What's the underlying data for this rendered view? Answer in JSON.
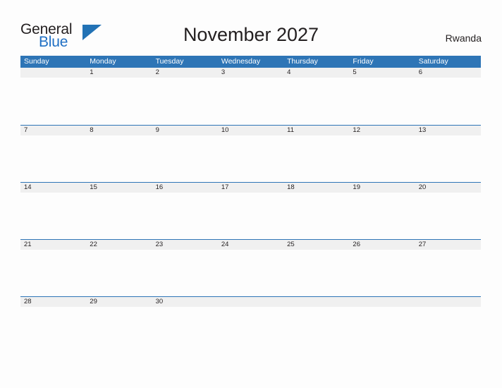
{
  "brand": {
    "word_one": "General",
    "word_two": "Blue",
    "triangle_icon": "triangle-icon",
    "accent_color": "#2272b5",
    "blue_text_color": "#1f6fc4"
  },
  "header": {
    "title": "November 2027",
    "country": "Rwanda"
  },
  "calendar": {
    "month": "November",
    "year": "2027",
    "header_color": "#2e75b6",
    "band_color": "#f0f0f0",
    "weekdays": [
      "Sunday",
      "Monday",
      "Tuesday",
      "Wednesday",
      "Thursday",
      "Friday",
      "Saturday"
    ],
    "weeks": [
      {
        "days": [
          {
            "label": ""
          },
          {
            "label": "1"
          },
          {
            "label": "2"
          },
          {
            "label": "3"
          },
          {
            "label": "4"
          },
          {
            "label": "5"
          },
          {
            "label": "6"
          }
        ]
      },
      {
        "days": [
          {
            "label": "7"
          },
          {
            "label": "8"
          },
          {
            "label": "9"
          },
          {
            "label": "10"
          },
          {
            "label": "11"
          },
          {
            "label": "12"
          },
          {
            "label": "13"
          }
        ]
      },
      {
        "days": [
          {
            "label": "14"
          },
          {
            "label": "15"
          },
          {
            "label": "16"
          },
          {
            "label": "17"
          },
          {
            "label": "18"
          },
          {
            "label": "19"
          },
          {
            "label": "20"
          }
        ]
      },
      {
        "days": [
          {
            "label": "21"
          },
          {
            "label": "22"
          },
          {
            "label": "23"
          },
          {
            "label": "24"
          },
          {
            "label": "25"
          },
          {
            "label": "26"
          },
          {
            "label": "27"
          }
        ]
      },
      {
        "days": [
          {
            "label": "28"
          },
          {
            "label": "29"
          },
          {
            "label": "30"
          },
          {
            "label": ""
          },
          {
            "label": ""
          },
          {
            "label": ""
          },
          {
            "label": ""
          }
        ]
      }
    ]
  }
}
